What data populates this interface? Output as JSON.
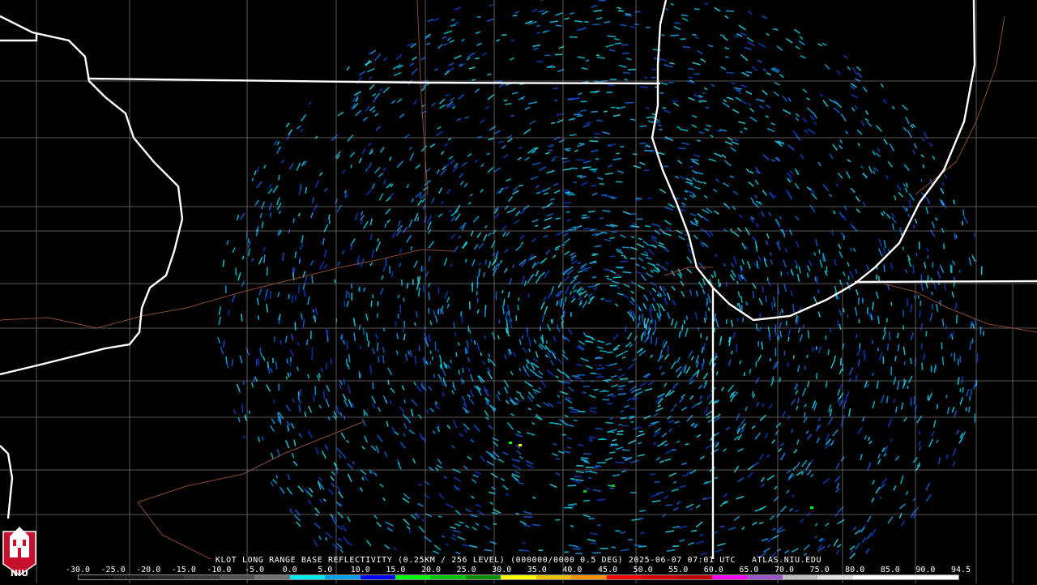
{
  "caption": {
    "radar": "KLOT",
    "product": "LONG RANGE BASE REFLECTIVITY",
    "resolution": "(0.25KM / 256 LEVEL)",
    "code": "(000000/0000 0.5 DEG)",
    "timestamp": "2025-06-07 07:01 UTC",
    "source": "ATLAS.NIU.EDU"
  },
  "scale": {
    "labels": [
      "-30.0",
      "-25.0",
      "-20.0",
      "-15.0",
      "-10.0",
      "-5.0",
      "0.0",
      "5.0",
      "10.0",
      "15.0",
      "20.0",
      "25.0",
      "30.0",
      "35.0",
      "40.0",
      "45.0",
      "50.0",
      "55.0",
      "60.0",
      "65.0",
      "70.0",
      "75.0",
      "80.0",
      "85.0",
      "90.0",
      "94.5"
    ],
    "colors": [
      "#0a0a0a",
      "#1a1a1a",
      "#2a2a2a",
      "#3a3a3a",
      "#505050",
      "#707070",
      "#00ecec",
      "#01a0f6",
      "#0000f6",
      "#00ff00",
      "#00c800",
      "#009000",
      "#ffff00",
      "#e7c000",
      "#ff9000",
      "#ff0000",
      "#d60000",
      "#c00000",
      "#ff00ff",
      "#9955c9",
      "#c0c0c0",
      "#e0e0e0",
      "#ffffff",
      "#ffffff",
      "#ffffff"
    ]
  },
  "logo": {
    "text": "NIU",
    "color": "#c8102e"
  },
  "map": {
    "radar_site": "KLOT",
    "echo_colors": [
      "#00c8dc",
      "#18a0e8",
      "#1060d8",
      "#0a3cc8",
      "#28d8e8"
    ]
  }
}
